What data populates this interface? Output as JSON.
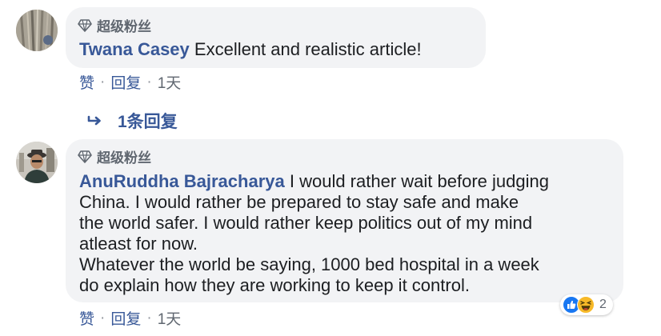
{
  "comments": [
    {
      "badge": "超级粉丝",
      "author": "Twana Casey",
      "text": "Excellent and realistic article!",
      "actions": {
        "like": "赞",
        "reply": "回复",
        "time": "1天"
      },
      "replies_label": "1条回复"
    },
    {
      "badge": "超级粉丝",
      "author": "AnuRuddha Bajracharya",
      "text_first_line": "I would rather wait before judging",
      "text_rest": "China. I would rather be prepared to stay safe and make\nthe world safer. I would rather keep politics out of my mind\natleast for now.\nWhatever the world be saying, 1000 bed hospital in a week\ndo explain how they are working to keep it control.",
      "actions": {
        "like": "赞",
        "reply": "回复",
        "time": "1天"
      },
      "reactions": {
        "icons": [
          "like-reaction-icon",
          "haha-reaction-icon"
        ],
        "count": "2"
      }
    }
  ],
  "separator": "·",
  "colors": {
    "link": "#385898",
    "bubble": "#f2f3f5",
    "text": "#1c1e21",
    "meta": "#606770",
    "like_blue": "#1877f2",
    "haha_yellow": "#f7b928"
  }
}
